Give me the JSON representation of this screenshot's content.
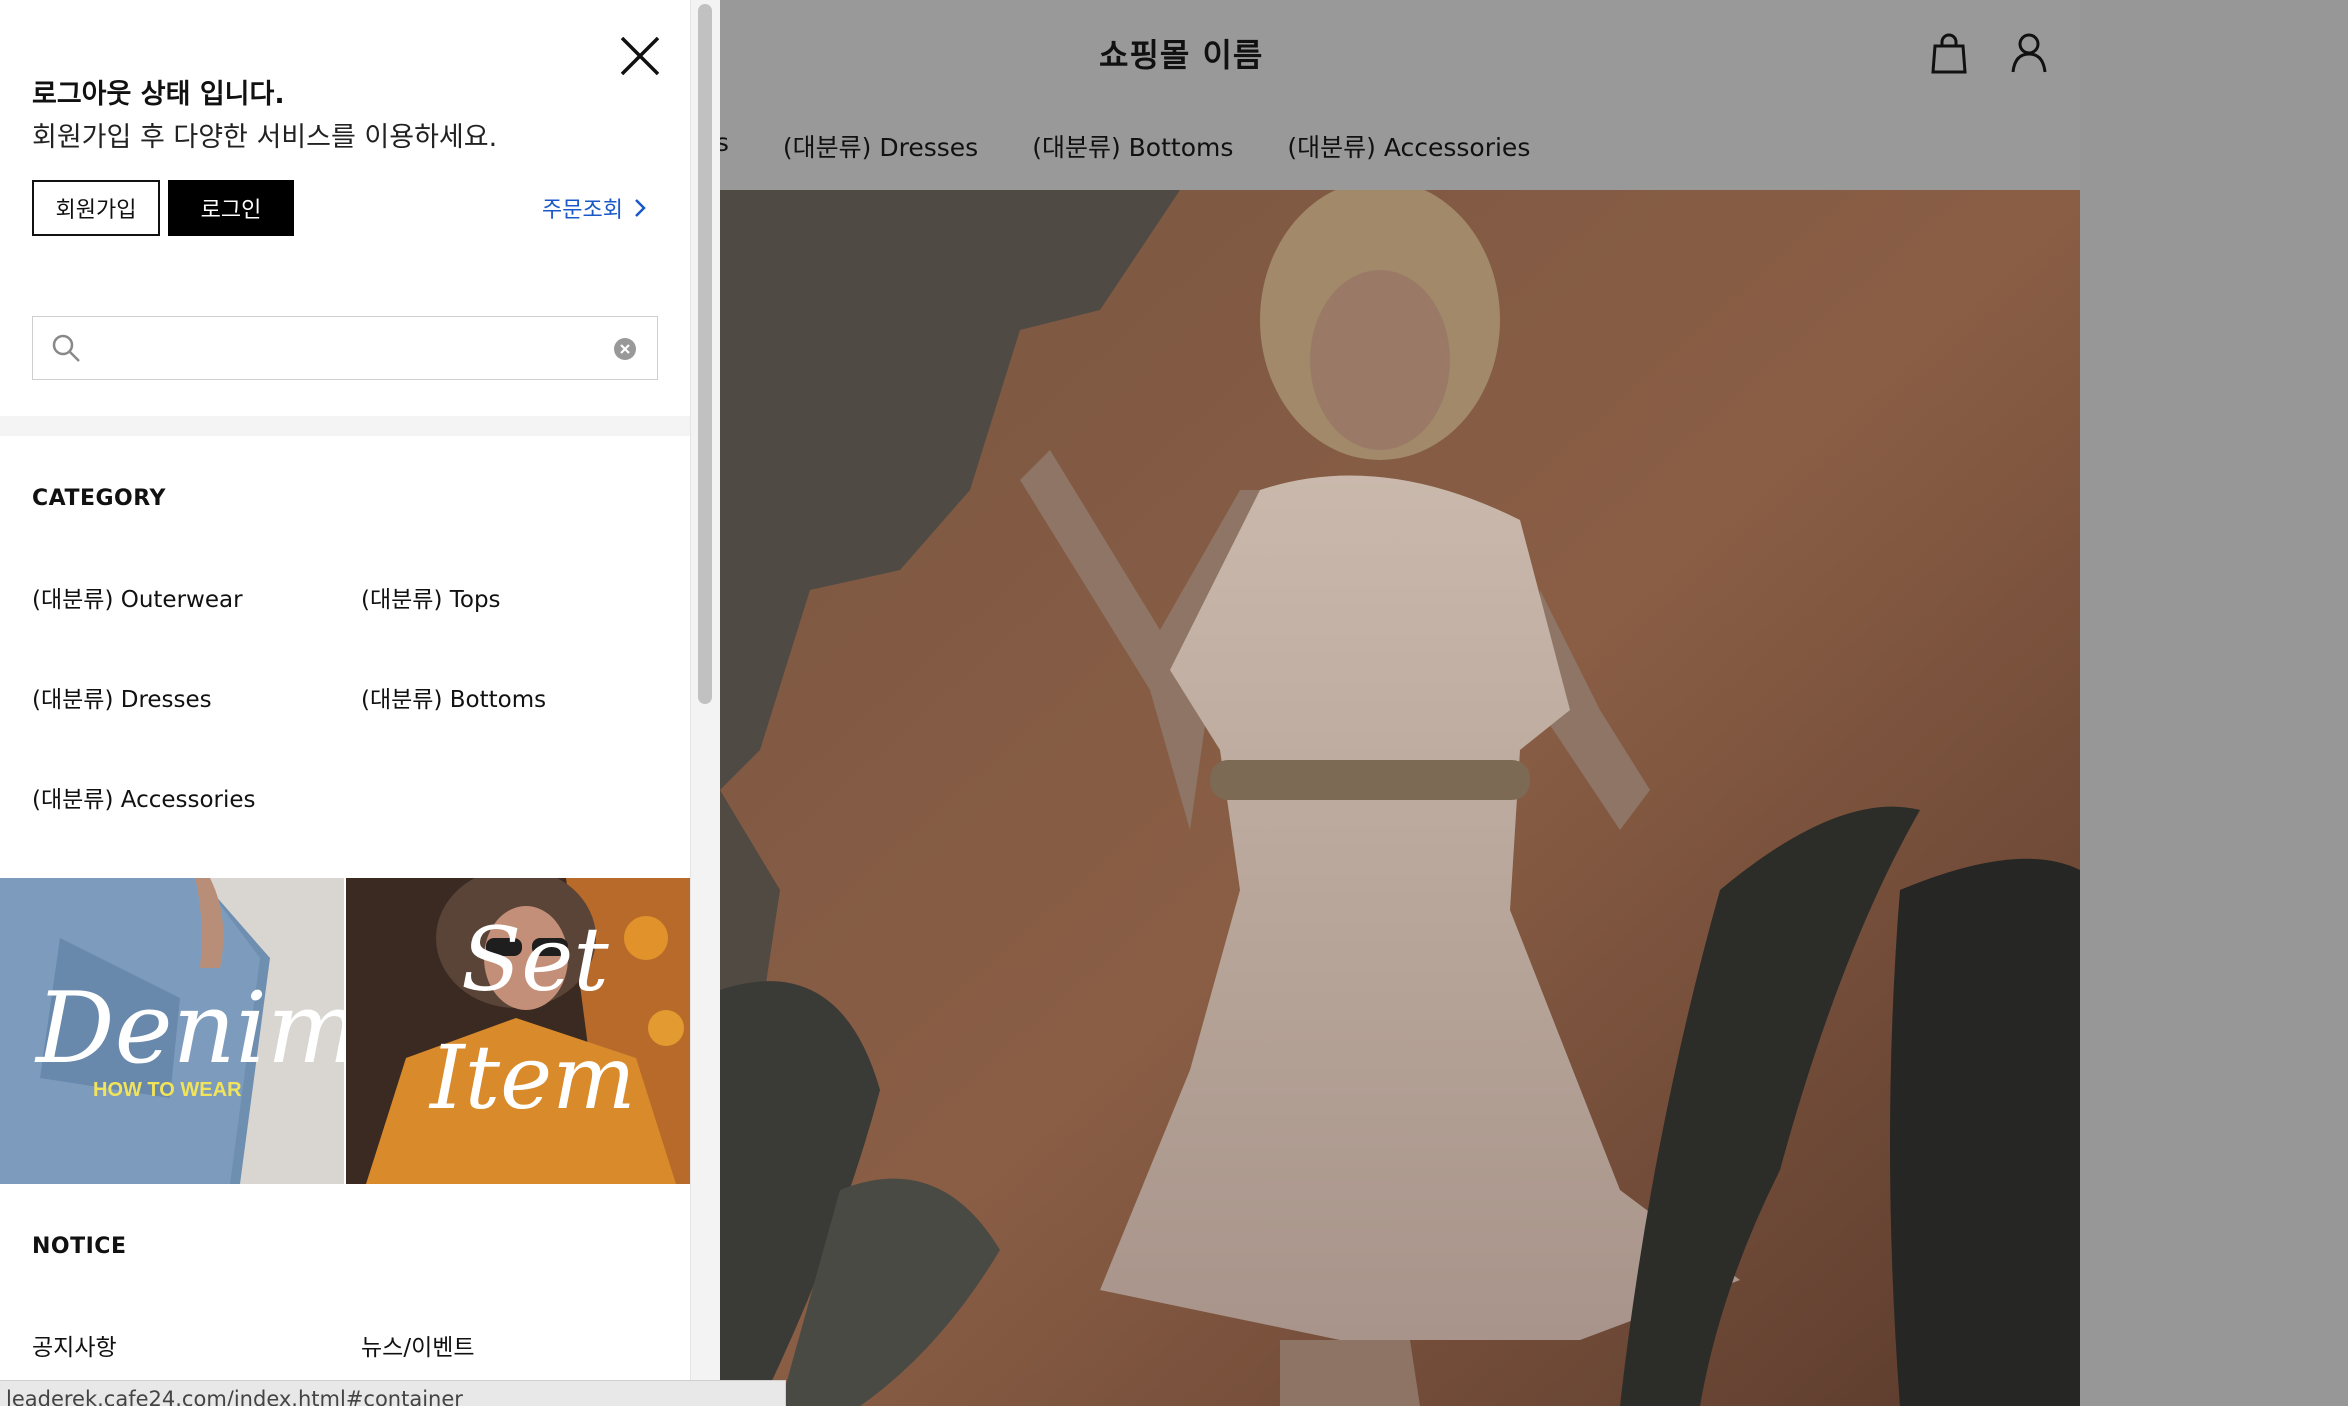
{
  "header": {
    "site_title": "쇼핑몰 이름",
    "cart_icon": "shopping-bag-icon",
    "user_icon": "user-icon"
  },
  "top_nav": {
    "items": [
      {
        "label": "ps"
      },
      {
        "label": "(대분류) Dresses"
      },
      {
        "label": "(대분류) Bottoms"
      },
      {
        "label": "(대분류) Accessories"
      }
    ]
  },
  "drawer": {
    "close_icon": "close-icon",
    "status_title": "로그아웃 상태 입니다.",
    "status_sub": "회원가입 후 다양한 서비스를 이용하세요.",
    "join_label": "회원가입",
    "login_label": "로그인",
    "order_label": "주문조회",
    "search": {
      "value": "",
      "placeholder": ""
    },
    "category_title": "CATEGORY",
    "categories": [
      {
        "label": "(대분류) Outerwear"
      },
      {
        "label": "(대분류) Tops"
      },
      {
        "label": "(대분류) Dresses"
      },
      {
        "label": "(대분류) Bottoms"
      },
      {
        "label": "(대분류) Accessories"
      }
    ],
    "banners": [
      {
        "big": "Denim",
        "small": "HOW TO WEAR"
      },
      {
        "big_line1": "Set",
        "big_line2": "Item"
      }
    ],
    "notice_title": "NOTICE",
    "notice_items": [
      {
        "label": "공지사항"
      },
      {
        "label": "뉴스/이벤트"
      }
    ]
  },
  "statusbar": {
    "url": "leaderek.cafe24.com/index.html#container"
  },
  "colors": {
    "overlay": "#999999",
    "link": "#1a58c8",
    "accent_yellow": "#f1e45a"
  }
}
